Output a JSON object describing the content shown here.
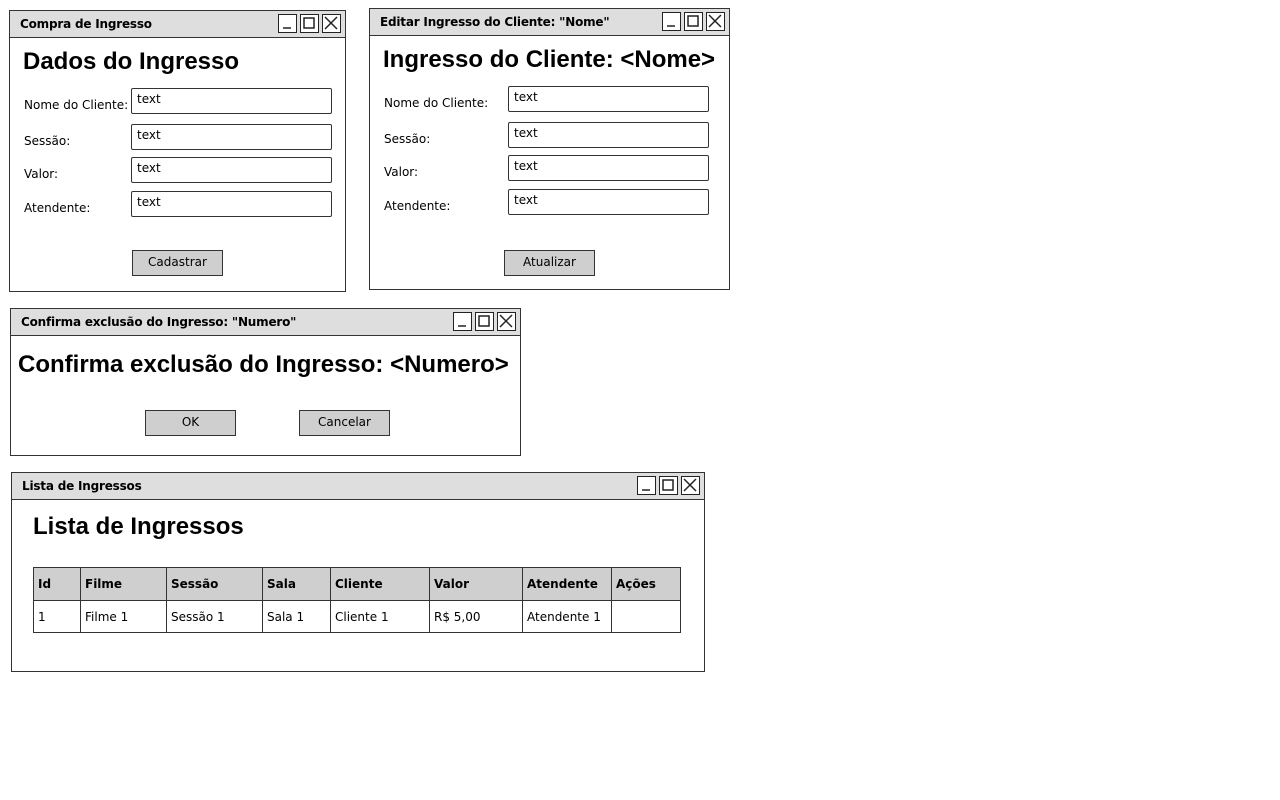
{
  "compra": {
    "window_title": "Compra de Ingresso",
    "heading": "Dados do Ingresso",
    "fields": [
      {
        "label": "Nome do Cliente:",
        "value": "text"
      },
      {
        "label": "Sessão:",
        "value": "text"
      },
      {
        "label": "Valor:",
        "value": "text"
      },
      {
        "label": "Atendente:",
        "value": "text"
      }
    ],
    "submit_label": "Cadastrar"
  },
  "editar": {
    "window_title": "Editar Ingresso do Cliente: \"Nome\"",
    "heading": "Ingresso do Cliente: <Nome>",
    "fields": [
      {
        "label": "Nome do Cliente:",
        "value": "text"
      },
      {
        "label": "Sessão:",
        "value": "text"
      },
      {
        "label": "Valor:",
        "value": "text"
      },
      {
        "label": "Atendente:",
        "value": "text"
      }
    ],
    "submit_label": "Atualizar"
  },
  "confirma": {
    "window_title": "Confirma exclusão do Ingresso: \"Numero\"",
    "heading": "Confirma exclusão do Ingresso: <Numero>",
    "ok_label": "OK",
    "cancel_label": "Cancelar"
  },
  "lista": {
    "window_title": "Lista de Ingressos",
    "heading": "Lista de Ingressos",
    "columns": [
      "Id",
      "Filme",
      "Sessão",
      "Sala",
      "Cliente",
      "Valor",
      "Atendente",
      "Ações"
    ],
    "rows": [
      [
        "1",
        "Filme 1",
        "Sessão 1",
        "Sala 1",
        "Cliente 1",
        "R$ 5,00",
        "Atendente 1",
        ""
      ]
    ]
  }
}
